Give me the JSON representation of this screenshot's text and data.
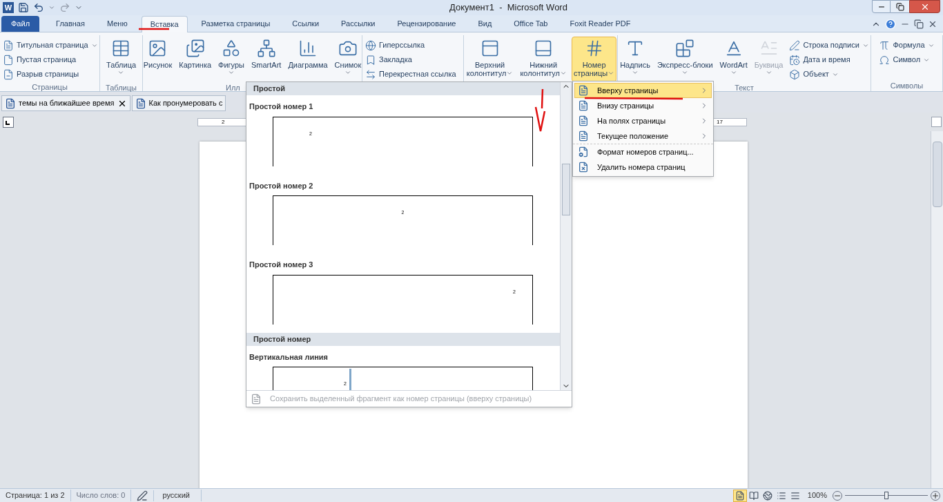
{
  "title_bar": {
    "app_icon": "W",
    "title": "Документ1  -  Microsoft Word"
  },
  "tabs": [
    {
      "label": "Файл",
      "kind": "file",
      "selected": false
    },
    {
      "label": "Главная",
      "kind": "tab",
      "selected": false
    },
    {
      "label": "Меню",
      "kind": "tab",
      "selected": false
    },
    {
      "label": "Вставка",
      "kind": "tab",
      "selected": true
    },
    {
      "label": "Разметка страницы",
      "kind": "tab",
      "selected": false
    },
    {
      "label": "Ссылки",
      "kind": "tab",
      "selected": false
    },
    {
      "label": "Рассылки",
      "kind": "tab",
      "selected": false
    },
    {
      "label": "Рецензирование",
      "kind": "tab",
      "selected": false
    },
    {
      "label": "Вид",
      "kind": "tab",
      "selected": false
    },
    {
      "label": "Office Tab",
      "kind": "tab",
      "selected": false
    },
    {
      "label": "Foxit Reader PDF",
      "kind": "tab",
      "selected": false
    }
  ],
  "ribbon": {
    "groups": [
      {
        "label": "Страницы",
        "small": [
          {
            "label": "Титульная страница",
            "has_menu": true
          },
          {
            "label": "Пустая страница",
            "has_menu": false
          },
          {
            "label": "Разрыв страницы",
            "has_menu": false
          }
        ]
      },
      {
        "label": "Таблицы",
        "large": [
          {
            "lines": [
              "Таблица"
            ],
            "has_menu": true,
            "selected": false,
            "disabled": false
          }
        ]
      },
      {
        "label": "Илл",
        "large": [
          {
            "lines": [
              "Рисунок"
            ],
            "has_menu": false,
            "selected": false,
            "disabled": false
          },
          {
            "lines": [
              "Картинка"
            ],
            "has_menu": false,
            "selected": false,
            "disabled": false
          },
          {
            "lines": [
              "Фигуры"
            ],
            "has_menu": true,
            "selected": false,
            "disabled": false
          },
          {
            "lines": [
              "SmartArt"
            ],
            "has_menu": false,
            "selected": false,
            "disabled": false
          },
          {
            "lines": [
              "Диаграмма"
            ],
            "has_menu": false,
            "selected": false,
            "disabled": false
          },
          {
            "lines": [
              "Снимок"
            ],
            "has_menu": true,
            "selected": false,
            "disabled": false
          }
        ]
      },
      {
        "small": [
          {
            "label": "Гиперссылка",
            "has_menu": false
          },
          {
            "label": "Закладка",
            "has_menu": false
          },
          {
            "label": "Перекрестная ссылка",
            "has_menu": false
          }
        ]
      },
      {
        "large": [
          {
            "lines": [
              "Верхний",
              "колонтитул"
            ],
            "has_menu": true,
            "selected": false,
            "disabled": false
          },
          {
            "lines": [
              "Нижний",
              "колонтитул"
            ],
            "has_menu": true,
            "selected": false,
            "disabled": false
          },
          {
            "lines": [
              "Номер",
              "страницы"
            ],
            "has_menu": true,
            "selected": true,
            "disabled": false
          }
        ]
      },
      {
        "label": "Текст",
        "large": [
          {
            "lines": [
              "Надпись"
            ],
            "has_menu": true,
            "selected": false,
            "disabled": false
          },
          {
            "lines": [
              "Экспресс-блоки"
            ],
            "has_menu": true,
            "selected": false,
            "disabled": false
          },
          {
            "lines": [
              "WordArt"
            ],
            "has_menu": true,
            "selected": false,
            "disabled": false
          },
          {
            "lines": [
              "Буквица"
            ],
            "has_menu": true,
            "selected": false,
            "disabled": true
          }
        ],
        "small": [
          {
            "label": "Строка подписи",
            "has_menu": true
          },
          {
            "label": "Дата и время",
            "has_menu": false
          },
          {
            "label": "Объект",
            "has_menu": true
          }
        ]
      },
      {
        "label": "Символы",
        "small": [
          {
            "label": "Формула",
            "has_menu": true
          },
          {
            "label": "Символ",
            "has_menu": true
          }
        ]
      }
    ]
  },
  "doc_tabs": [
    {
      "label": "темы на ближайшее время",
      "closable": true
    },
    {
      "label": "Как пронумеровать с",
      "closable": false
    }
  ],
  "ruler": {
    "left_label": "2",
    "right_label": "17"
  },
  "gallery": {
    "sections": [
      {
        "title": "Простой",
        "items": [
          {
            "title": "Простой номер 1",
            "number": "2",
            "kind": "top-left"
          },
          {
            "title": "Простой номер 2",
            "number": "2",
            "kind": "top-center"
          },
          {
            "title": "Простой номер 3",
            "number": "2",
            "kind": "top-right"
          }
        ]
      },
      {
        "title": "Простой номер",
        "items": [
          {
            "title": "Вертикальная линия",
            "number": "2",
            "kind": "vertical-line"
          }
        ]
      }
    ],
    "footer": {
      "label": "Сохранить выделенный фрагмент как номер страницы (вверху страницы)",
      "disabled": true
    }
  },
  "submenu": [
    {
      "label": "Вверху страницы",
      "kind": "submenu",
      "selected": true
    },
    {
      "label": "Внизу страницы",
      "kind": "submenu",
      "selected": false
    },
    {
      "label": "На полях страницы",
      "kind": "submenu",
      "selected": false
    },
    {
      "label": "Текущее положение",
      "kind": "submenu",
      "selected": false
    },
    {
      "label": "Формат номеров страниц...",
      "kind": "command",
      "selected": false
    },
    {
      "label": "Удалить номера страниц",
      "kind": "command",
      "selected": false
    }
  ],
  "status_bar": {
    "page": "Страница: 1 из 2",
    "words": "Число слов: 0",
    "language": "русский",
    "views": [
      {
        "selected": true
      },
      {
        "selected": false
      },
      {
        "selected": false
      },
      {
        "selected": false
      },
      {
        "selected": false
      }
    ],
    "zoom": "100%",
    "zoom_slider": {
      "level": 0.5
    }
  }
}
